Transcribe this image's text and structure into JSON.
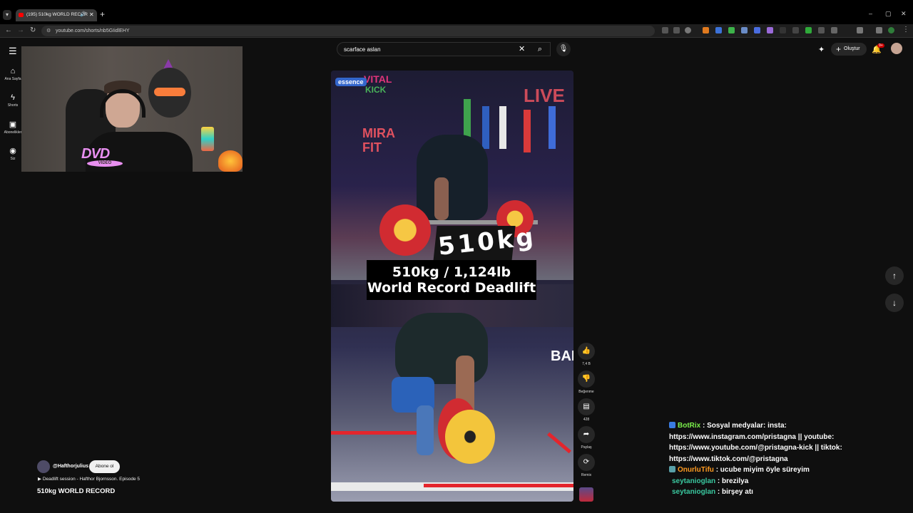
{
  "browser": {
    "tab_title": "(195) 510kg WORLD RECOR",
    "url": "youtube.com/shorts/nb5GIidlEHY",
    "new_tab": "+",
    "window_min": "–",
    "window_max": "▢",
    "window_close": "✕"
  },
  "sidebar": {
    "items": [
      {
        "label": "Ana Sayfa"
      },
      {
        "label": "Shorts"
      },
      {
        "label": "Abonelikler"
      },
      {
        "label": "Siz"
      }
    ]
  },
  "webcam": {
    "overlay_logo": "DVD",
    "overlay_logo_sub": "VIDEO"
  },
  "search": {
    "query": "scarface aslan"
  },
  "header": {
    "create_label": "Oluştur",
    "notifications_badge": "9+"
  },
  "short": {
    "banners": {
      "vital": "VITAL",
      "kick": "KICK",
      "essence": "essence",
      "live": "LIVE",
      "mira": "MIRA",
      "fit": "FIT",
      "bai": "BAI"
    },
    "scoreboard": "510kg",
    "caption_line1": "510kg / 1,124lb",
    "caption_line2": "World Record Deadlift"
  },
  "actions": {
    "like_count": "7,4 B",
    "dislike_label": "Beğenme",
    "comment_count": "428",
    "share_label": "Paylaş",
    "remix_label": "Remix"
  },
  "channel": {
    "handle": "@Hafthorjulius",
    "subscribe_label": "Abone ol",
    "playlist": "Deadlift session - Hafthor Bjornsson. Episode 5",
    "title": "510kg WORLD RECORD"
  },
  "chat": [
    {
      "user": "BotRix",
      "user_color": "#7bf04b",
      "text": ": Sosyal medyalar: insta: https://www.instagram.com/pristagna || youtube: https://www.youtube.com/@pristagna-kick || tiktok: https://www.tiktok.com/@pristagna"
    },
    {
      "user": "OnurluTifu",
      "user_color": "#ff9b21",
      "text": ": ucube miyim öyle süreyim"
    },
    {
      "user": "seytanioglan",
      "user_color": "#3ac9a0",
      "text": ": brezilya"
    },
    {
      "user": "seytanioglan",
      "user_color": "#3ac9a0",
      "text": ": birşey atı"
    }
  ],
  "colors": {
    "accent_red": "#cc0000",
    "bg": "#0f0f0f"
  }
}
